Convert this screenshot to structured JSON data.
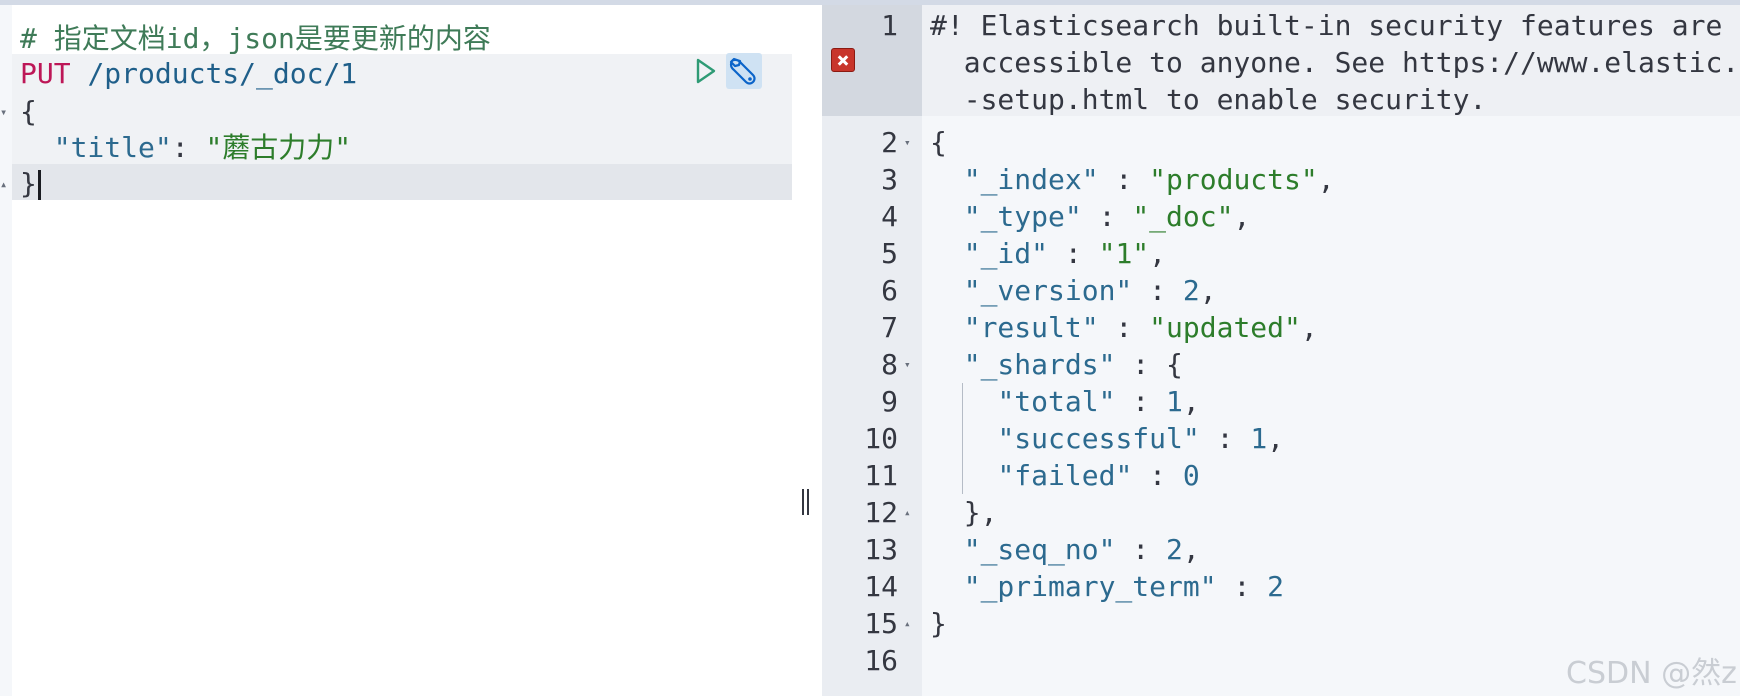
{
  "request": {
    "comment": "# 指定文档id，json是要更新的内容",
    "method": "PUT",
    "path": "/products/_doc/1",
    "body_open": "{",
    "body_key": "\"title\"",
    "body_sep": ": ",
    "body_value": "\"蘑古力力\"",
    "body_close": "}"
  },
  "response": {
    "warning_lines": [
      "#! Elasticsearch built-in security features are n",
      "  accessible to anyone. See https://www.elastic.c",
      "  -setup.html to enable security."
    ],
    "line_numbers": [
      "1",
      "2",
      "3",
      "4",
      "5",
      "6",
      "7",
      "8",
      "9",
      "10",
      "11",
      "12",
      "13",
      "14",
      "15",
      "16"
    ],
    "index_key": "\"_index\"",
    "index_val": "\"products\"",
    "type_key": "\"_type\"",
    "type_val": "\"_doc\"",
    "id_key": "\"_id\"",
    "id_val": "\"1\"",
    "version_key": "\"_version\"",
    "version_val": "2",
    "result_key": "\"result\"",
    "result_val": "\"updated\"",
    "shards_key": "\"_shards\"",
    "total_key": "\"total\"",
    "total_val": "1",
    "successful_key": "\"successful\"",
    "successful_val": "1",
    "failed_key": "\"failed\"",
    "failed_val": "0",
    "seq_key": "\"_seq_no\"",
    "seq_val": "2",
    "term_key": "\"_primary_term\"",
    "term_val": "2"
  },
  "watermark": "CSDN @然z",
  "icons": {
    "run": "play-icon",
    "settings": "wrench-icon",
    "error": "error-marker-icon",
    "splitter": "resize-handle-icon"
  }
}
